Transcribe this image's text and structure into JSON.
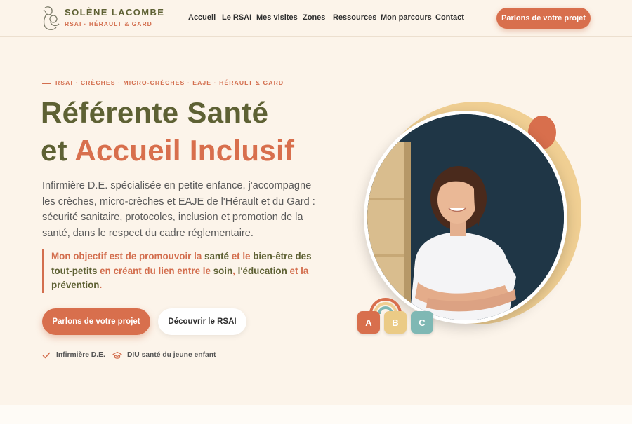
{
  "header": {
    "brand_name": "SOLÈNE LACOMBE",
    "brand_tag": "RSAI · HÉRAULT & GARD",
    "nav": [
      "Accueil",
      "Le RSAI",
      "Mes visites",
      "Zones",
      "Ressources",
      "Mon parcours",
      "Contact"
    ],
    "cta": "Parlons de votre projet"
  },
  "hero": {
    "eyebrow": "RSAI · CRÈCHES · MICRO-CRÈCHES · EAJE · HÉRAULT & GARD",
    "title_line1": "Référente Santé",
    "title_line2_prefix": "et",
    "title_line2_accent": "Accueil Inclusif",
    "intro": "Infirmière D.E. spécialisée en petite enfance, j'accompagne les crèches, micro-crèches et EAJE de l'Hérault et du Gard : sécurité sanitaire, protocoles, inclusion et promotion de la santé, dans le respect du cadre réglementaire.",
    "quote": {
      "p1": "Mon objectif est de promouvoir la ",
      "w1": "santé",
      "p2": " et le ",
      "w2": "bien-être des tout-petits",
      "p3": " en créant du lien entre le ",
      "w3": "soin",
      "p4": ", ",
      "w4": "l'éducation",
      "p5": " et la ",
      "w5": "prévention",
      "p6": "."
    },
    "btn_primary": "Parlons de votre projet",
    "btn_secondary": "Découvrir le RSAI",
    "badges": [
      "Infirmière D.E.",
      "DIU santé du jeune enfant"
    ],
    "abc": [
      "A",
      "B",
      "C"
    ]
  },
  "colors": {
    "accent": "#d86f4d",
    "olive": "#5e6134",
    "background": "#fcf4ea",
    "yellow": "#f0cf93",
    "teal": "#7fb8b4"
  },
  "icons": {
    "logo": "mother-child-logo",
    "badge1": "check-icon",
    "badge2": "graduation-cap-icon"
  }
}
